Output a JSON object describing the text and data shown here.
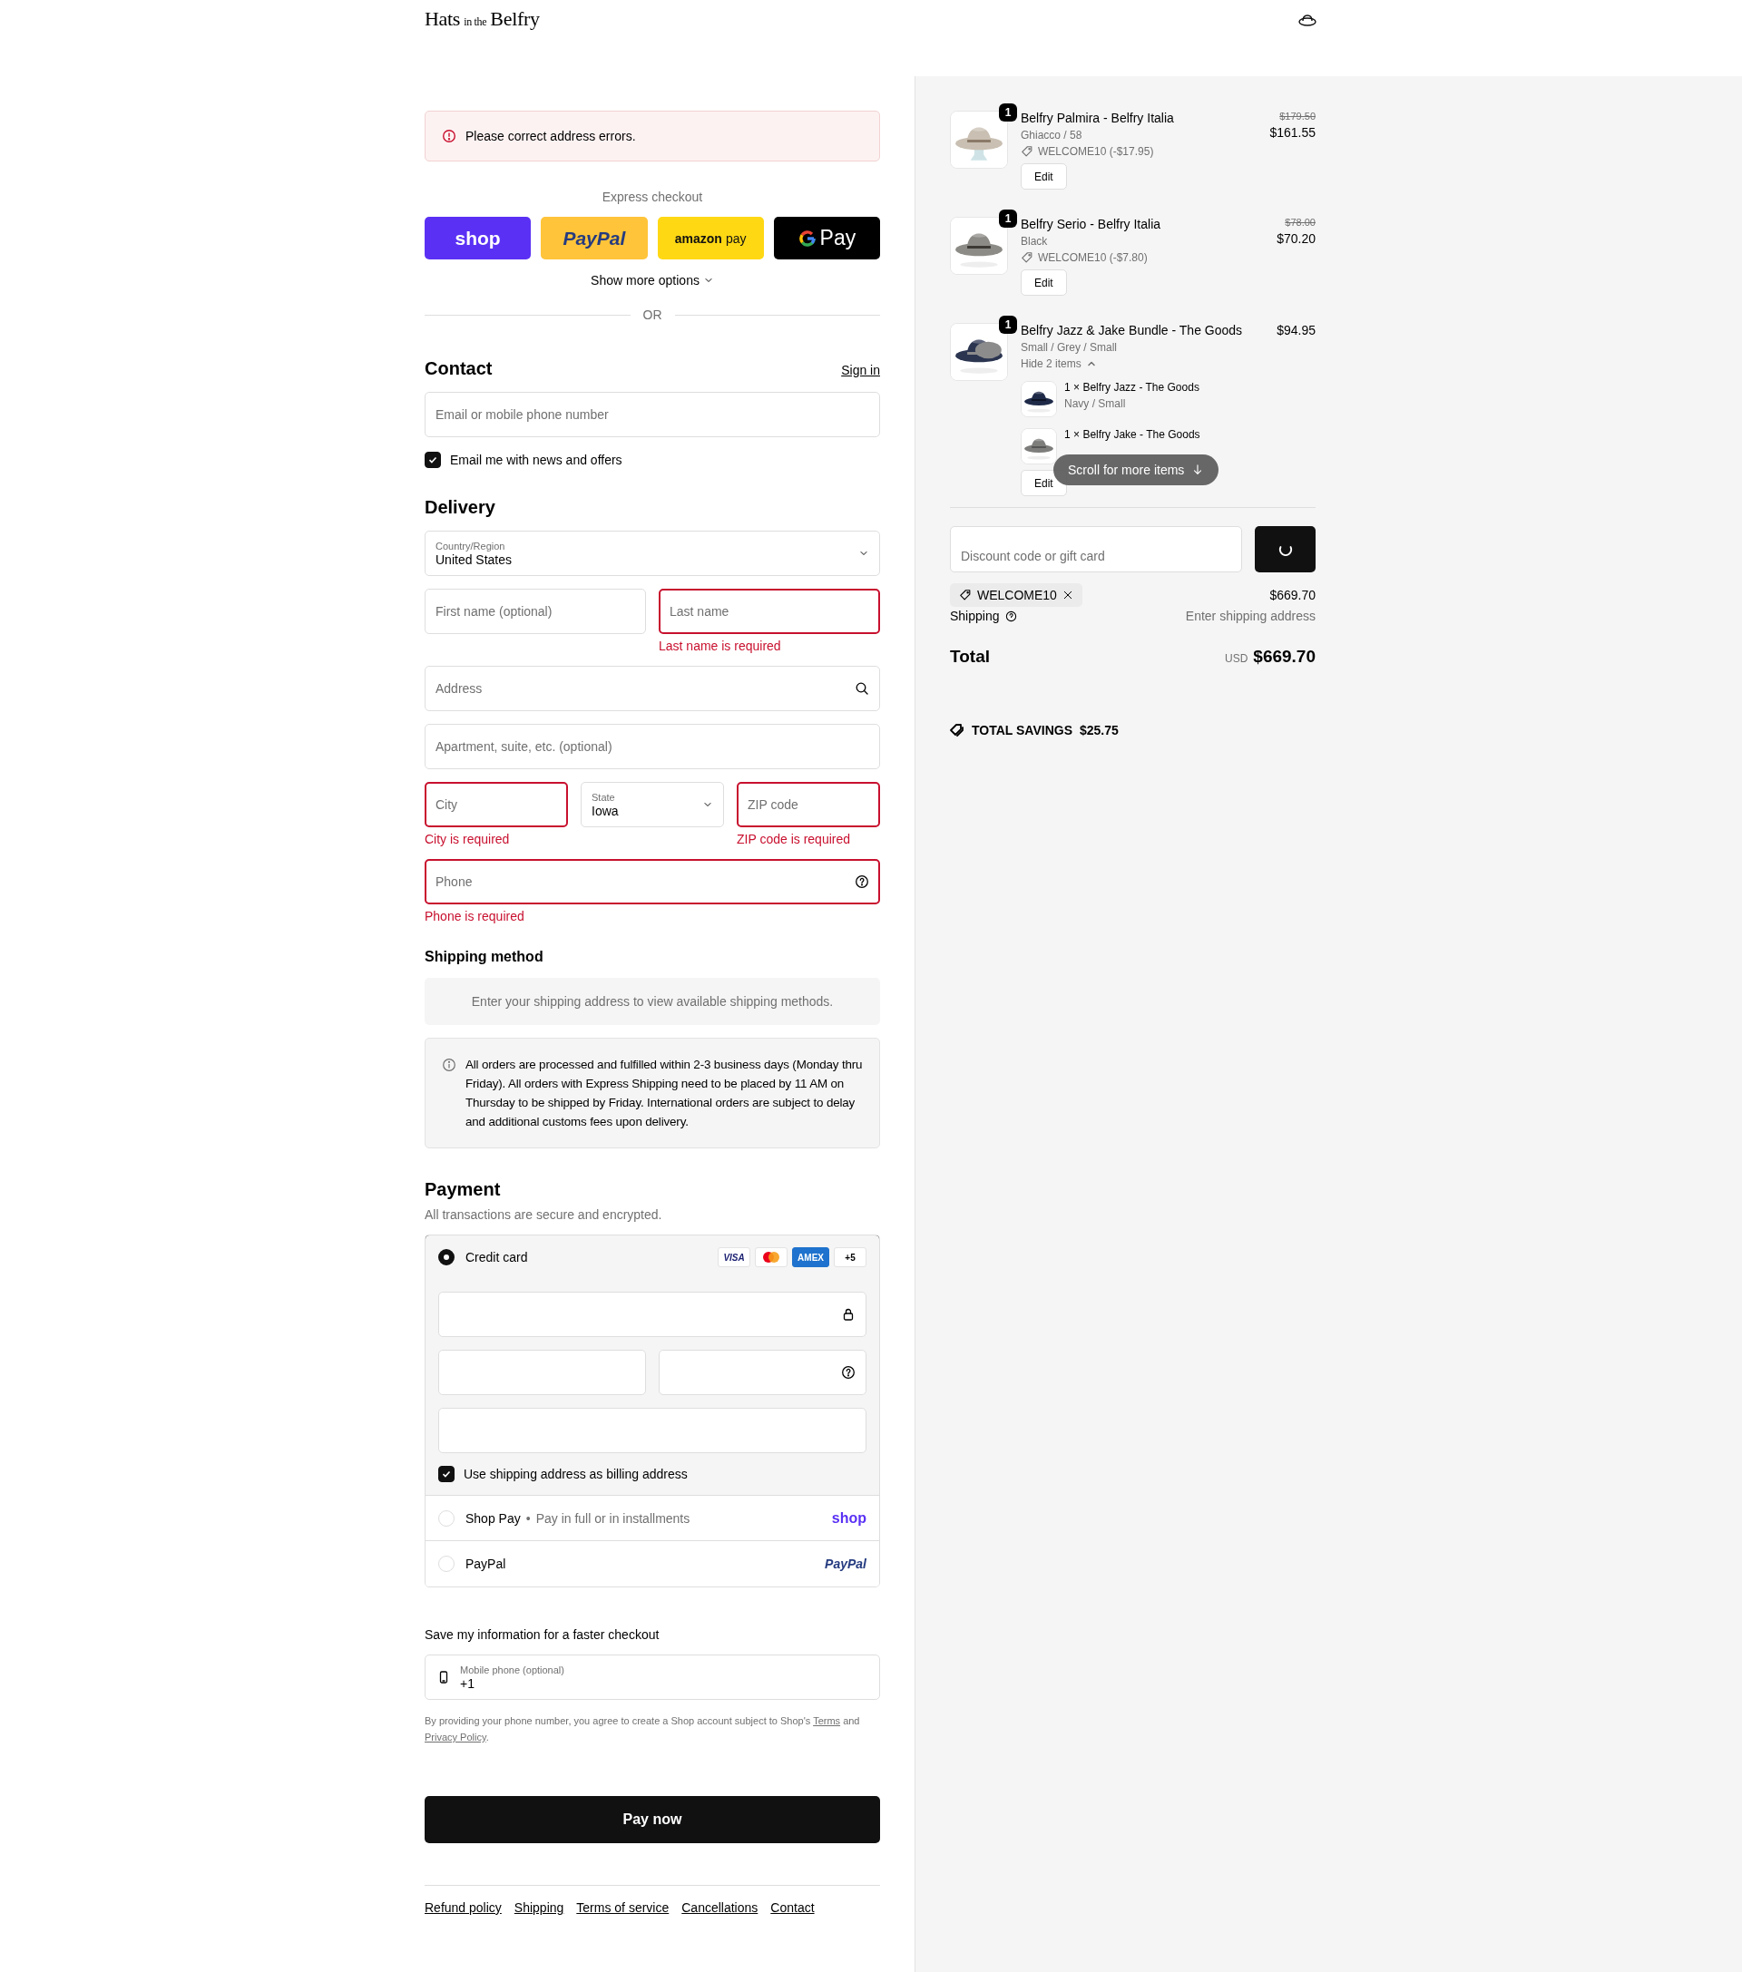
{
  "header": {
    "logo": {
      "main": "Hats",
      "small": "in the",
      "end": "Belfry"
    }
  },
  "alert": {
    "message": "Please correct address errors."
  },
  "express": {
    "title": "Express checkout",
    "buttons": [
      {
        "kind": "shop",
        "label": "shop"
      },
      {
        "kind": "paypal",
        "label": "PayPal"
      },
      {
        "kind": "amazon",
        "label": "amazon",
        "suffix": "pay"
      },
      {
        "kind": "gpay",
        "label": "Pay"
      }
    ],
    "more": "Show more options",
    "divider": "OR"
  },
  "contact": {
    "title": "Contact",
    "sign_in": "Sign in",
    "email": {
      "placeholder": "Email or mobile phone number"
    },
    "newsletter": {
      "label": "Email me with news and offers",
      "checked": true
    }
  },
  "delivery": {
    "title": "Delivery",
    "rows": [
      [
        {
          "kind": "select",
          "label": "Country/Region",
          "value": "United States"
        }
      ],
      [
        {
          "kind": "text",
          "placeholder": "First name (optional)"
        },
        {
          "kind": "text",
          "placeholder": "Last name",
          "error": "Last name is required"
        }
      ],
      [
        {
          "kind": "address",
          "placeholder": "Address"
        }
      ],
      [
        {
          "kind": "text",
          "placeholder": "Apartment, suite, etc. (optional)"
        }
      ],
      [
        {
          "kind": "text",
          "placeholder": "City",
          "error": "City is required"
        },
        {
          "kind": "select",
          "label": "State",
          "value": "Iowa"
        },
        {
          "kind": "text",
          "placeholder": "ZIP code",
          "error": "ZIP code is required"
        }
      ],
      [
        {
          "kind": "phone",
          "placeholder": "Phone",
          "error": "Phone is required"
        }
      ]
    ]
  },
  "shipping_method": {
    "title": "Shipping method",
    "message": "Enter your shipping address to view available shipping methods.",
    "notice": "All orders are processed and fulfilled within 2-3 business days (Monday thru Friday). All orders with Express Shipping need to be placed by 11 AM on Thursday to be shipped by Friday. International orders are subject to delay and additional customs fees upon delivery."
  },
  "payment": {
    "title": "Payment",
    "subtitle": "All transactions are secure and encrypted.",
    "methods": [
      {
        "kind": "card",
        "label": "Credit card",
        "selected": true,
        "brands": [
          {
            "kind": "visa",
            "label": "VISA"
          },
          {
            "kind": "mastercard"
          },
          {
            "kind": "amex",
            "label": "AMEX"
          },
          {
            "kind": "more",
            "label": "+5"
          }
        ],
        "billing": {
          "label": "Use shipping address as billing address",
          "checked": true
        }
      },
      {
        "kind": "shop_pay",
        "label": "Shop Pay",
        "separator": "•",
        "detail": "Pay in full or in installments",
        "logo": "shop",
        "selected": false
      },
      {
        "kind": "paypal",
        "label": "PayPal",
        "logo": "PayPal",
        "selected": false
      }
    ]
  },
  "remember": {
    "title": "Save my information for a faster checkout",
    "phone": {
      "label": "Mobile phone (optional)",
      "value": "+1"
    },
    "disclaimer": [
      {
        "kind": "text",
        "text": "By providing your phone number, you agree to create a Shop account subject to Shop's "
      },
      {
        "kind": "link",
        "text": "Terms"
      },
      {
        "kind": "text",
        "text": " and "
      },
      {
        "kind": "link",
        "text": "Privacy Policy"
      },
      {
        "kind": "text",
        "text": "."
      }
    ]
  },
  "pay_button": "Pay now",
  "footer_links": [
    "Refund policy",
    "Shipping",
    "Terms of service",
    "Cancellations",
    "Contact"
  ],
  "summary": {
    "items": [
      {
        "quantity": "1",
        "name": "Belfry Palmira - Belfry Italia",
        "variant": "Ghiacco / 58",
        "discount": "WELCOME10 (-$17.95)",
        "compare_price": "$179.50",
        "price": "$161.55",
        "edit": "Edit"
      },
      {
        "quantity": "1",
        "name": "Belfry Serio - Belfry Italia",
        "variant": "Black",
        "discount": "WELCOME10 (-$7.80)",
        "compare_price": "$78.00",
        "price": "$70.20",
        "edit": "Edit"
      },
      {
        "quantity": "1",
        "name": "Belfry Jazz & Jake Bundle - The Goods",
        "variant": "Small / Grey / Small",
        "price": "$94.95",
        "toggle": {
          "label": "Hide 2 items",
          "expanded": true
        },
        "children": [
          {
            "quantity": "1",
            "times": "×",
            "name": "Belfry Jazz - The Goods",
            "variant": "Navy / Small"
          },
          {
            "quantity": "1",
            "times": "×",
            "name": "Belfry Jake - The Goods"
          }
        ],
        "edit": "Edit"
      }
    ],
    "scroll_hint": "Scroll for more items",
    "discount": {
      "placeholder": "Discount code or gift card"
    },
    "applied_code": "WELCOME10",
    "subtotal": "$669.70",
    "shipping": {
      "label": "Shipping",
      "value": "Enter shipping address"
    },
    "total": {
      "label": "Total",
      "currency": "USD",
      "amount": "$669.70"
    },
    "savings": {
      "label": "TOTAL SAVINGS",
      "amount": "$25.75"
    }
  }
}
